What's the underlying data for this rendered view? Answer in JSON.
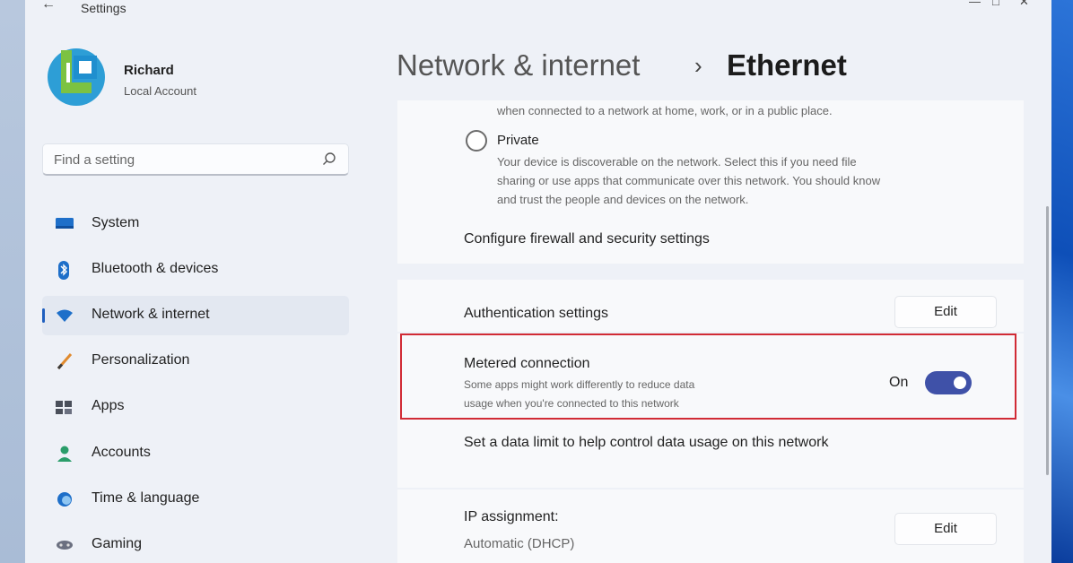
{
  "window": {
    "title": "Settings"
  },
  "user": {
    "name": "Richard",
    "account_type": "Local Account"
  },
  "search": {
    "placeholder": "Find a setting"
  },
  "nav": {
    "items": [
      {
        "label": "System",
        "icon": "monitor-icon"
      },
      {
        "label": "Bluetooth & devices",
        "icon": "bluetooth-icon"
      },
      {
        "label": "Network & internet",
        "icon": "wifi-icon",
        "selected": true
      },
      {
        "label": "Personalization",
        "icon": "brush-icon"
      },
      {
        "label": "Apps",
        "icon": "apps-icon"
      },
      {
        "label": "Accounts",
        "icon": "person-icon"
      },
      {
        "label": "Time & language",
        "icon": "globe-clock-icon"
      },
      {
        "label": "Gaming",
        "icon": "controller-icon"
      }
    ]
  },
  "breadcrumb": {
    "parent": "Network & internet",
    "separator": "›",
    "current": "Ethernet"
  },
  "network_profile": {
    "public_desc_tail": "when connected to a network at home, work, or in a public place.",
    "private_label": "Private",
    "private_desc_line1": "Your device is discoverable on the network. Select this if you need file",
    "private_desc_line2": "sharing or use apps that communicate over this network. You should know",
    "private_desc_line3": "and trust the people and devices on the network.",
    "firewall_link": "Configure firewall and security settings"
  },
  "authentication": {
    "label": "Authentication settings",
    "button": "Edit"
  },
  "metered": {
    "title": "Metered connection",
    "desc_line1": "Some apps might work differently to reduce data",
    "desc_line2": "usage when you're connected to this network",
    "state_label": "On",
    "enabled": true,
    "data_limit_link": "Set a data limit to help control data usage on this network"
  },
  "ip": {
    "label": "IP assignment:",
    "value": "Automatic (DHCP)",
    "button": "Edit"
  },
  "colors": {
    "accent": "#3f51a8",
    "highlight_border": "#d12b35"
  }
}
